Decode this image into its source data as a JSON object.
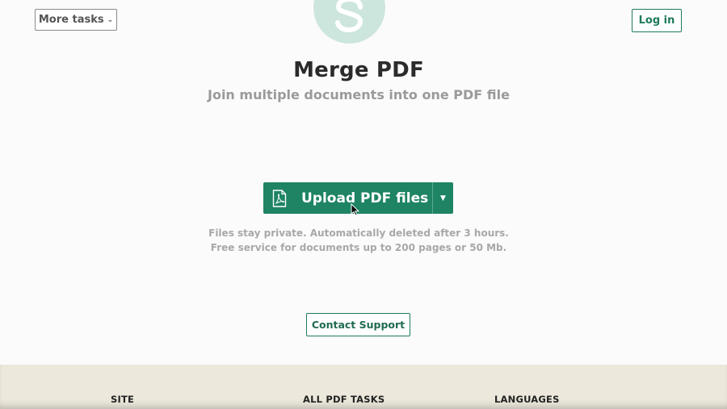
{
  "header": {
    "more_tasks_label": "More tasks",
    "login_label": "Log in"
  },
  "hero": {
    "title": "Merge PDF",
    "subtitle": "Join multiple documents into one PDF file"
  },
  "upload": {
    "button_label": "Upload PDF files",
    "icon": "pdf-file-icon",
    "dropdown_icon": "caret-down-icon"
  },
  "privacy": {
    "line1": "Files stay private. Automatically deleted after 3 hours.",
    "line2": "Free service for documents up to 200 pages or 50 Mb."
  },
  "support": {
    "contact_label": "Contact Support"
  },
  "footer": {
    "columns": [
      {
        "heading": "SITE"
      },
      {
        "heading": "ALL PDF TASKS"
      },
      {
        "heading": "LANGUAGES"
      }
    ]
  },
  "colors": {
    "brand_green": "#1e8463",
    "logo_mint": "#cde6dd",
    "footer_bg": "#ece8dc"
  }
}
